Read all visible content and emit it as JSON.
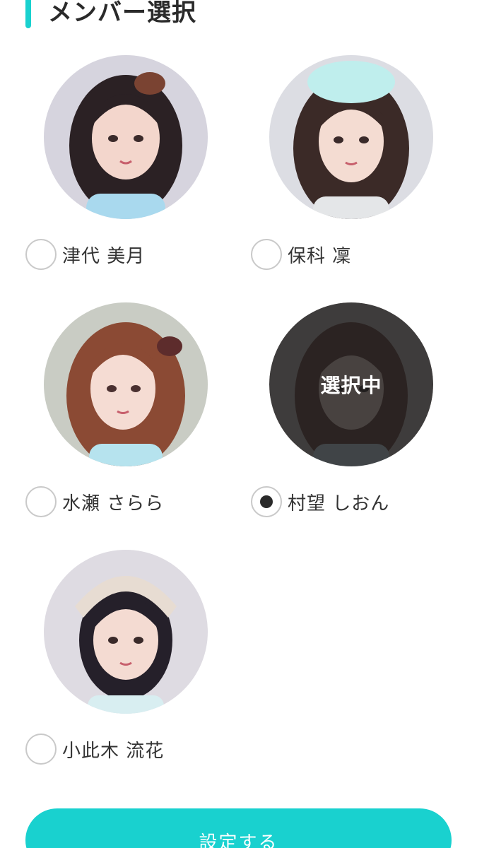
{
  "header": {
    "title": "メンバー選択"
  },
  "members": [
    {
      "name": "津代 美月",
      "selected": false,
      "hair": "#2b2124",
      "accent": "#7a4332",
      "bg": "#d6d4de",
      "outfit": "#a9d9ee"
    },
    {
      "name": "保科 凜",
      "selected": false,
      "hair": "#3b2a27",
      "accent": "#bfeeed",
      "bg": "#dcdde3",
      "outfit": "#e4e6e8"
    },
    {
      "name": "水瀬 さらら",
      "selected": false,
      "hair": "#8b4a34",
      "accent": "#5d2c2c",
      "bg": "#c9ccc4",
      "outfit": "#b6e3ee"
    },
    {
      "name": "村望 しおん",
      "selected": true,
      "hair": "#6b4740",
      "accent": "#8a5c55",
      "bg": "#bfb8b4",
      "outfit": "#c9dbe6"
    },
    {
      "name": "小此木 流花",
      "selected": false,
      "hair": "#25202a",
      "accent": "#e7dcd2",
      "bg": "#dedbe2",
      "outfit": "#d8eef1"
    }
  ],
  "selected_label": "選択中",
  "submit": {
    "label": "設定する"
  },
  "colors": {
    "accent": "#19d1cf",
    "text": "#333333",
    "overlay": "#191919"
  }
}
